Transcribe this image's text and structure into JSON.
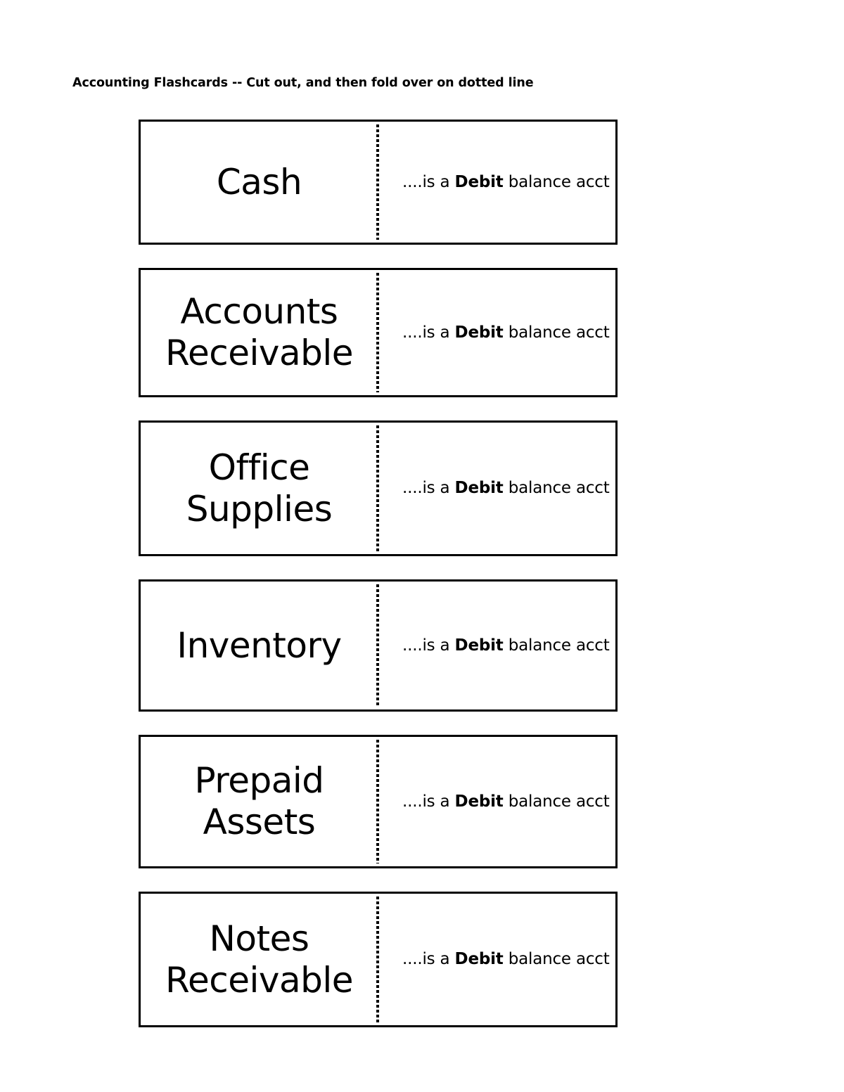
{
  "document": {
    "title": "Accounting Flashcards -- Cut out, and then fold over on dotted line",
    "background_color": "#ffffff",
    "text_color": "#000000",
    "border_color": "#000000"
  },
  "cards": [
    {
      "front": "Cash",
      "back_prefix": "....is a ",
      "back_emphasis": "Debit",
      "back_suffix": " balance acct"
    },
    {
      "front": "Accounts\nReceivable",
      "back_prefix": "....is a ",
      "back_emphasis": "Debit",
      "back_suffix": " balance acct"
    },
    {
      "front": "Office\nSupplies",
      "back_prefix": "....is a ",
      "back_emphasis": "Debit",
      "back_suffix": " balance acct"
    },
    {
      "front": "Inventory",
      "back_prefix": "....is a ",
      "back_emphasis": "Debit",
      "back_suffix": " balance acct"
    },
    {
      "front": "Prepaid\nAssets",
      "back_prefix": "....is a ",
      "back_emphasis": "Debit",
      "back_suffix": " balance acct"
    },
    {
      "front": "Notes\nReceivable",
      "back_prefix": "....is a ",
      "back_emphasis": "Debit",
      "back_suffix": " balance acct"
    }
  ]
}
